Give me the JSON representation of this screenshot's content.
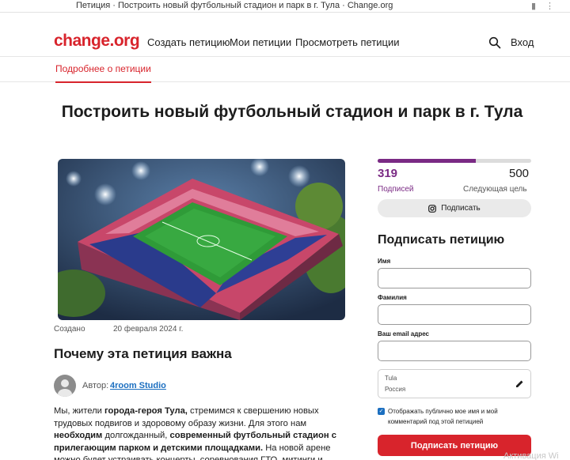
{
  "browser": {
    "window_title": "Петиция · Построить новый футбольный стадион и парк в г. Тула · Change.org"
  },
  "header": {
    "logo": "change.org",
    "nav": [
      "Создать петицию",
      "Мои петиции",
      "Просмотреть петиции"
    ],
    "login": "Вход",
    "search_icon": "search-icon"
  },
  "subnav": {
    "tab": "Подробнее о петиции"
  },
  "petition": {
    "title": "Построить новый футбольный стадион и парк в г. Тула",
    "created_label": "Создано",
    "created_date": "20 февраля 2024 г.",
    "why_heading": "Почему эта петиция важна",
    "author_label": "Автор:",
    "author_name": "4room Studio",
    "description_parts": {
      "p1": "Мы, жители ",
      "b1": "города-героя Тула,",
      "p2": " стремимся к свершению новых трудовых подвигов и здоровому образу жизни. Для этого нам ",
      "b2": "необходим",
      "p3": " долгожданный, ",
      "b3": "современный футбольный стадион с прилегающим парком и детскими площадками.",
      "p4": " На новой арене можно будет устраивать концерты, соревнования ГТО, митинги и другие"
    }
  },
  "signatures": {
    "count": "319",
    "goal": "500",
    "progress_fraction": 0.638,
    "count_label": "Подписей",
    "goal_label": "Следующая цель",
    "share_button": "Подписать",
    "share_icon": "instagram-icon"
  },
  "form": {
    "heading": "Подписать петицию",
    "first_name_label": "Имя",
    "last_name_label": "Фамилия",
    "email_label": "Ваш email адрес",
    "first_name_value": "",
    "last_name_value": "",
    "email_value": "",
    "city": "Tula",
    "country": "Россия",
    "consent_text": "Отображать публично мое имя и мой комментарий под этой петицией",
    "consent_checked": true,
    "submit": "Подписать петицию"
  },
  "os": {
    "watermark": "Активация Wi"
  },
  "colors": {
    "brand_red": "#d8242c",
    "progress_purple": "#7a2a84",
    "link_blue": "#1c6fc0"
  }
}
